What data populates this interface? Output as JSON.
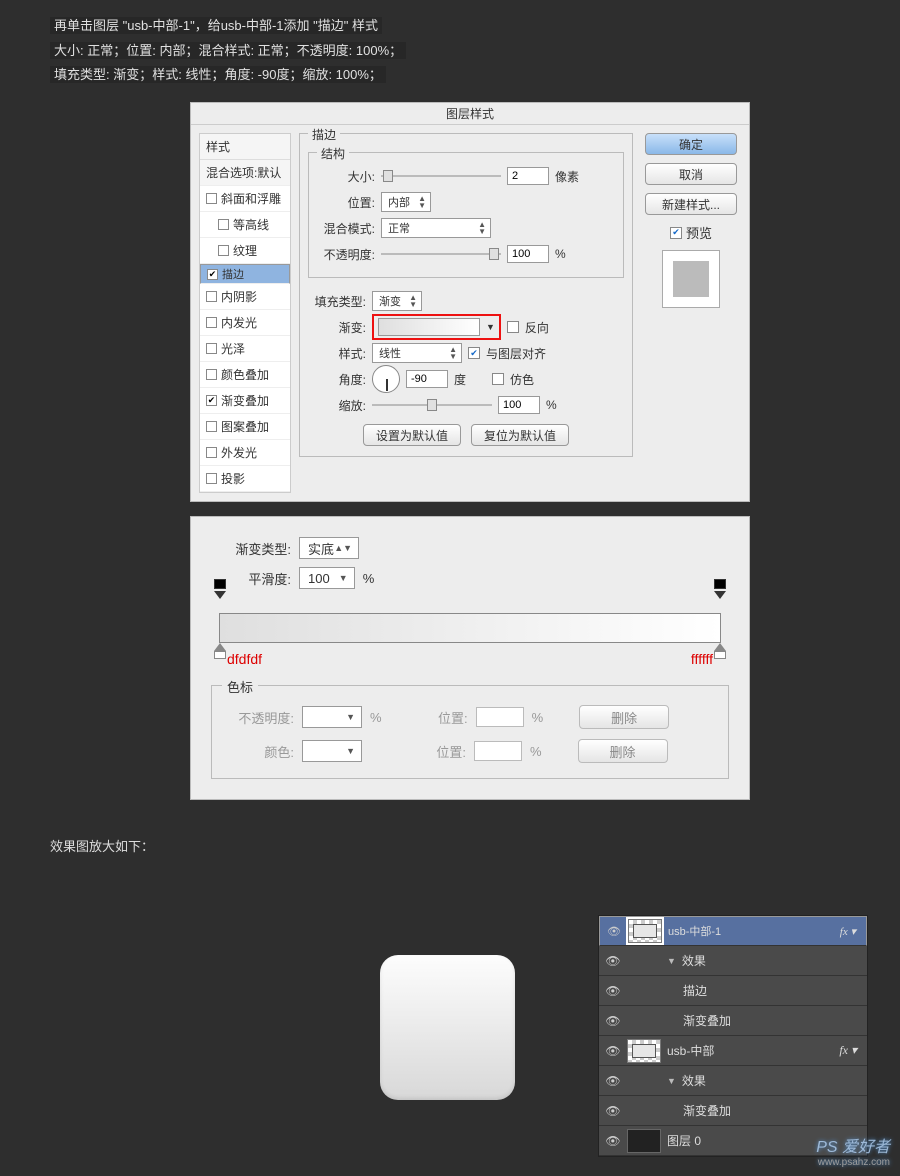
{
  "intro": {
    "line1": "再单击图层 \"usb-中部-1\"，给usb-中部-1添加 \"描边\" 样式",
    "line2": "大小: 正常；位置: 内部；混合样式: 正常；不透明度: 100%；",
    "line3": "填充类型: 渐变；样式: 线性；角度: -90度；缩放: 100%；"
  },
  "dialog": {
    "title": "图层样式",
    "sidebar": {
      "header": "样式",
      "blend": "混合选项:默认",
      "items": [
        {
          "label": "斜面和浮雕",
          "checked": false,
          "indent": false
        },
        {
          "label": "等高线",
          "checked": false,
          "indent": true
        },
        {
          "label": "纹理",
          "checked": false,
          "indent": true
        },
        {
          "label": "描边",
          "checked": true,
          "indent": false,
          "selected": true
        },
        {
          "label": "内阴影",
          "checked": false,
          "indent": false
        },
        {
          "label": "内发光",
          "checked": false,
          "indent": false
        },
        {
          "label": "光泽",
          "checked": false,
          "indent": false
        },
        {
          "label": "颜色叠加",
          "checked": false,
          "indent": false
        },
        {
          "label": "渐变叠加",
          "checked": true,
          "indent": false
        },
        {
          "label": "图案叠加",
          "checked": false,
          "indent": false
        },
        {
          "label": "外发光",
          "checked": false,
          "indent": false
        },
        {
          "label": "投影",
          "checked": false,
          "indent": false
        }
      ]
    },
    "stroke": {
      "group": "描边",
      "struct": "结构",
      "size_label": "大小:",
      "size_value": "2",
      "size_unit": "像素",
      "pos_label": "位置:",
      "pos_value": "内部",
      "blend_label": "混合模式:",
      "blend_value": "正常",
      "opacity_label": "不透明度:",
      "opacity_value": "100",
      "opacity_unit": "%",
      "fill_label": "填充类型:",
      "fill_value": "渐变",
      "grad_label": "渐变:",
      "reverse_label": "反向",
      "style_label": "样式:",
      "style_value": "线性",
      "align_label": "与图层对齐",
      "angle_label": "角度:",
      "angle_value": "-90",
      "angle_unit": "度",
      "dither_label": "仿色",
      "scale_label": "缩放:",
      "scale_value": "100",
      "scale_unit": "%",
      "reset_default": "设置为默认值",
      "restore_default": "复位为默认值"
    },
    "side": {
      "ok": "确定",
      "cancel": "取消",
      "new_style": "新建样式...",
      "preview": "预览"
    }
  },
  "grad_editor": {
    "type_label": "渐变类型:",
    "type_value": "实底",
    "smooth_label": "平滑度:",
    "smooth_value": "100",
    "smooth_unit": "%",
    "left_hex": "dfdfdf",
    "right_hex": "ffffff",
    "stops_title": "色标",
    "opacity_label": "不透明度:",
    "opacity_unit": "%",
    "pos_label": "位置:",
    "pos_unit": "%",
    "delete": "删除",
    "color_label": "颜色:"
  },
  "sub_caption": "效果图放大如下：",
  "layers": {
    "rows": [
      {
        "name": "usb-中部-1",
        "fx": true,
        "selected": true,
        "thumb": "checker"
      },
      {
        "name": "效果",
        "fx": false,
        "type": "fxgroup"
      },
      {
        "name": "描边",
        "fx": false,
        "type": "fxitem"
      },
      {
        "name": "渐变叠加",
        "fx": false,
        "type": "fxitem"
      },
      {
        "name": "usb-中部",
        "fx": true,
        "thumb": "checker"
      },
      {
        "name": "效果",
        "fx": false,
        "type": "fxgroup"
      },
      {
        "name": "渐变叠加",
        "fx": false,
        "type": "fxitem"
      },
      {
        "name": "图层 0",
        "fx": false,
        "thumb": "solid"
      }
    ]
  },
  "watermark": {
    "brand": "PS 爱好者",
    "url": "www.psahz.com"
  }
}
